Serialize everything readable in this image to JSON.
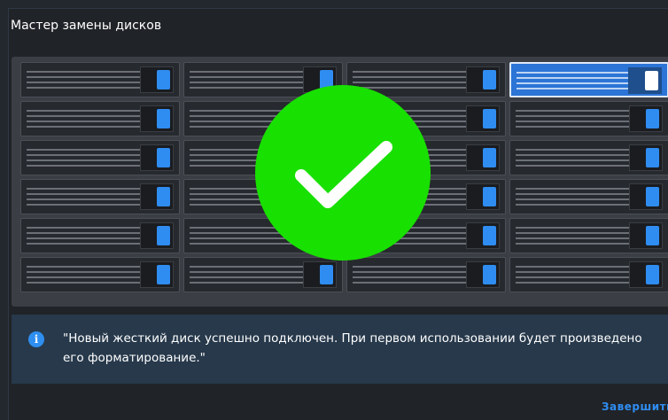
{
  "window": {
    "title": "Мастер замены дисков"
  },
  "enclosure": {
    "columns": 4,
    "rows": 6,
    "selected_bay": 4,
    "colors": {
      "led": "#2f8df2",
      "selected": "#2c74d6",
      "success": "#18e000"
    }
  },
  "status": {
    "icon": "checkmark-icon",
    "state": "success"
  },
  "message": {
    "icon": "info-icon",
    "text": "\"Новый жесткий диск успешно подключен. При первом использовании будет произведено его форматирование.\""
  },
  "footer": {
    "finish_label": "Завершить"
  }
}
